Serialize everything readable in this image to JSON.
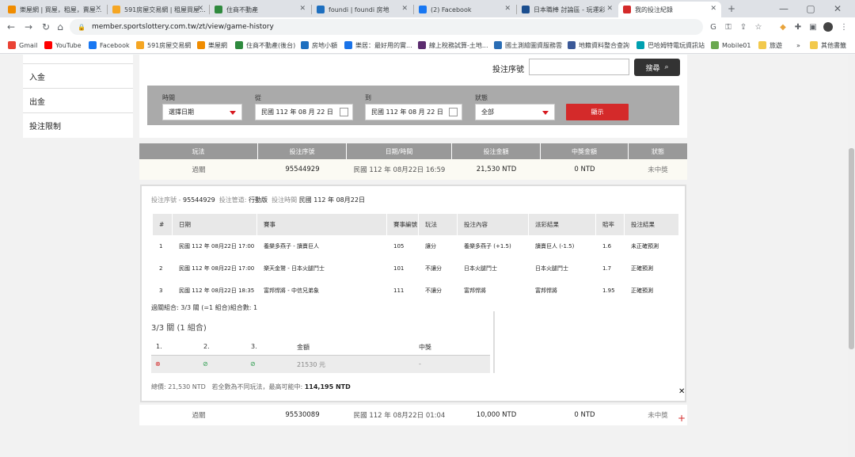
{
  "browser": {
    "tabs": [
      {
        "title": "樂屋網 | 買屋，租屋，賣屋...",
        "fav_color": "#f08c00"
      },
      {
        "title": "591房屋交易網 | 租屋買屋...",
        "fav_color": "#f5a623"
      },
      {
        "title": "住商不動產",
        "fav_color": "#2f8a3e"
      },
      {
        "title": "foundi | foundi 房地",
        "fav_color": "#1e6fbf"
      },
      {
        "title": "(2) Facebook",
        "fav_color": "#1877f2"
      },
      {
        "title": "日本職棒 討論區 - 玩運彩",
        "fav_color": "#1b4e8f"
      },
      {
        "title": "我的投注紀錄",
        "fav_color": "#d42a2a"
      }
    ],
    "url": "member.sportslottery.com.tw/zt/view/game-history",
    "bookmarks": [
      {
        "label": "Gmail",
        "color": "#ea4335"
      },
      {
        "label": "YouTube",
        "color": "#ff0000"
      },
      {
        "label": "Facebook",
        "color": "#1877f2"
      },
      {
        "label": "591房屋交易網",
        "color": "#f5a623"
      },
      {
        "label": "樂屋網",
        "color": "#f08c00"
      },
      {
        "label": "住商不動產(後台)",
        "color": "#2f8a3e"
      },
      {
        "label": "房地小額",
        "color": "#1e6fbf"
      },
      {
        "label": "樂居：最好用的實...",
        "color": "#1a73e8"
      },
      {
        "label": "線上稅務試算-土地...",
        "color": "#5b2c6f"
      },
      {
        "label": "國土測繪圖資服務雲",
        "color": "#2a6db5"
      },
      {
        "label": "地籍資料整合查詢",
        "color": "#3b5998"
      },
      {
        "label": "巴哈姆特電玩資訊站",
        "color": "#00a0b0"
      },
      {
        "label": "Mobile01",
        "color": "#6aa84f"
      },
      {
        "label": "旅遊",
        "color": "#f2c94c"
      },
      {
        "label": "其他書籤",
        "color": "#f2c94c"
      }
    ]
  },
  "sidebar": {
    "items": [
      "入金",
      "出金",
      "投注限制"
    ]
  },
  "search": {
    "label": "投注序號",
    "value": "",
    "button": "搜尋"
  },
  "filter": {
    "time_label": "時間",
    "time_value": "選擇日期",
    "from_label": "從",
    "from_value": "民國 112 年 08 月 22 日",
    "to_label": "到",
    "to_value": "民國 112 年 08 月 22 日",
    "status_label": "狀態",
    "status_value": "全部",
    "show_button": "顯示"
  },
  "results": {
    "headers": [
      "玩法",
      "投注序號",
      "日期/時間",
      "投注金額",
      "中獎金額",
      "狀態"
    ],
    "rows": [
      [
        "過關",
        "95544929",
        "民國 112 年 08月22日 16:59",
        "21,530 NTD",
        "0 NTD",
        "未中獎"
      ],
      [
        "過關",
        "95530089",
        "民國 112 年 08月22日 01:04",
        "10,000 NTD",
        "0 NTD",
        "未中獎"
      ]
    ]
  },
  "detail": {
    "serial_label": "投注序號 -",
    "serial": "95544929",
    "channel_label": "投注管道:",
    "channel": "行動版",
    "time_label": "投注時間",
    "time": "民國 112 年 08月22日",
    "headers": [
      "#",
      "日期",
      "賽事",
      "賽事編號",
      "玩法",
      "投注內容",
      "派彩結果",
      "賠率",
      "投注結果"
    ],
    "legs": [
      [
        "1",
        "民國 112 年 08月22日 17:00",
        "養樂多燕子 - 讀賣巨人",
        "105",
        "讓分",
        "養樂多燕子 (+1.5)",
        "讀賣巨人 (-1.5)",
        "1.6",
        "未正確預測"
      ],
      [
        "2",
        "民國 112 年 08月22日 17:00",
        "樂天金鷲 - 日本火腿鬥士",
        "101",
        "不讓分",
        "日本火腿鬥士",
        "日本火腿鬥士",
        "1.7",
        "正確預測"
      ],
      [
        "3",
        "民國 112 年 08月22日 18:35",
        "富邦悍將 - 中信兄弟象",
        "111",
        "不讓分",
        "富邦悍將",
        "富邦悍將",
        "1.95",
        "正確預測"
      ]
    ],
    "combo_line": "過關組合: 3/3 關 (=1 組合)組合數: 1",
    "combo_title": "3/3 關 (1 組合)",
    "combo_headers": [
      "1.",
      "2.",
      "3.",
      "金額",
      "中獎"
    ],
    "combo_row": {
      "amount": "21530 元",
      "win": "-"
    },
    "summary_total_label": "總價:",
    "summary_total": "21,530 NTD",
    "summary_note": "若全數為不同玩法，最高可能中:",
    "summary_max": "114,195 NTD"
  }
}
